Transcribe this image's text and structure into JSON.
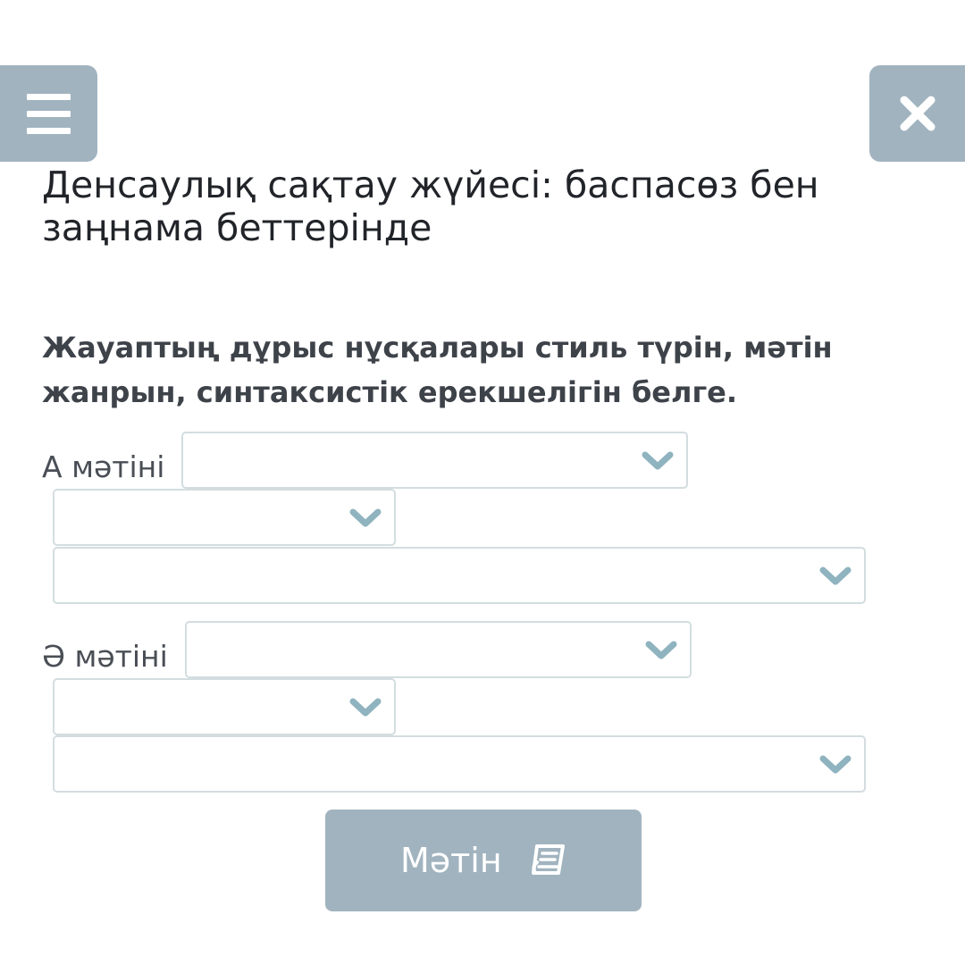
{
  "header": {
    "menu_icon": "hamburger-menu-icon",
    "close_icon": "close-x-icon",
    "button_color": "#a1b3bf"
  },
  "lesson": {
    "title": "Денсаулық сақтау жүйесі: баспасөз бен заңнама беттерінде"
  },
  "task": {
    "instruction": "Жауаптың дұрыс нұсқалары стиль түрін, мәтін жанрын, синтаксистік ерекшелігін белге.",
    "groups": [
      {
        "label": "А мәтіні",
        "dropdowns": [
          {
            "selected": ""
          },
          {
            "selected": ""
          },
          {
            "selected": ""
          }
        ]
      },
      {
        "label": "Ә мәтіні",
        "dropdowns": [
          {
            "selected": ""
          },
          {
            "selected": ""
          },
          {
            "selected": ""
          }
        ]
      }
    ]
  },
  "footer": {
    "text_button_label": "Мәтін",
    "text_button_icon": "book-icon"
  },
  "colors": {
    "accent": "#a1b3bf",
    "chevron": "#8fb3bf",
    "dropdown_border": "#d3dde0"
  }
}
